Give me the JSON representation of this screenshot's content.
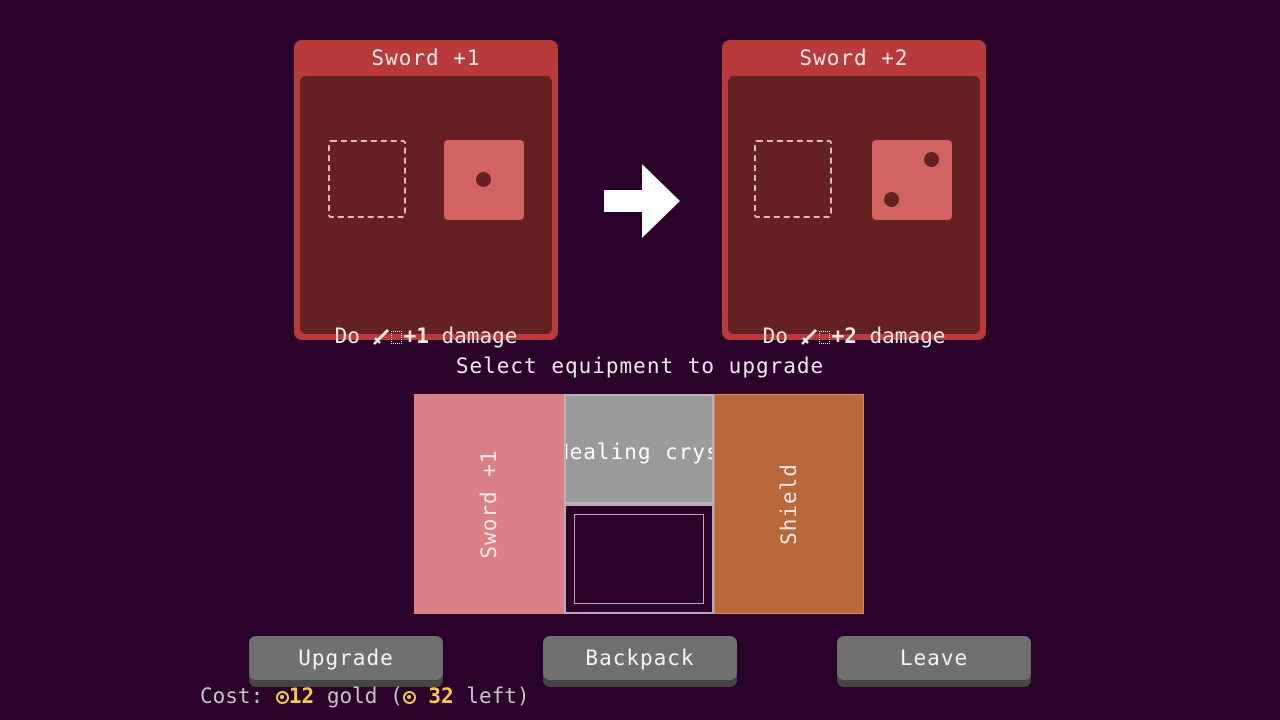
{
  "current_card": {
    "title": "Sword +1",
    "die_value": 1,
    "desc_prefix": "Do",
    "desc_amount": "+1",
    "desc_suffix": "damage"
  },
  "upgraded_card": {
    "title": "Sword +2",
    "die_value": 2,
    "desc_prefix": "Do",
    "desc_amount": "+2",
    "desc_suffix": "damage"
  },
  "prompt": "Select equipment to upgrade",
  "equipment": {
    "sword": "Sword +1",
    "healing_crystal": "Healing crystal",
    "shield": "Shield"
  },
  "buttons": {
    "upgrade": "Upgrade",
    "backpack": "Backpack",
    "leave": "Leave"
  },
  "cost": {
    "label": "Cost:",
    "amount": "12",
    "unit": "gold",
    "open": "(",
    "left_amount": "32",
    "left_label": "left)"
  },
  "colors": {
    "background": "#2a0128",
    "card": "#b93a3a",
    "sword_item": "#d98086",
    "crystal_item": "#9a9a9a",
    "shield_item": "#b8683a",
    "gold": "#f2c94c"
  },
  "icons": [
    "sword-icon",
    "dice-slot-icon",
    "right-arrow-icon",
    "gold-coin-icon"
  ]
}
